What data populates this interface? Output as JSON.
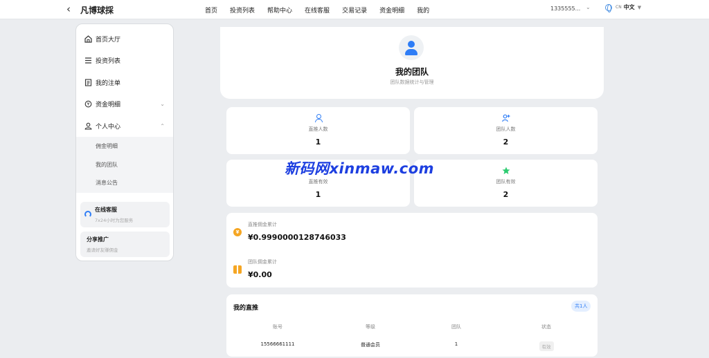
{
  "header": {
    "brand": "凡博球採",
    "nav": [
      "首页",
      "投资列表",
      "帮助中心",
      "在线客服",
      "交易记录",
      "资金明细",
      "我的"
    ],
    "account": "1335555...",
    "lang_code": "CN",
    "lang_name": "中文"
  },
  "sidebar": {
    "items": [
      {
        "label": "首页大厅",
        "icon": "home-icon"
      },
      {
        "label": "投资列表",
        "icon": "list-icon"
      },
      {
        "label": "我的注单",
        "icon": "document-icon"
      },
      {
        "label": "资金明细",
        "icon": "coin-icon"
      },
      {
        "label": "个人中心",
        "icon": "user-icon"
      }
    ],
    "submenu": [
      "佣金明细",
      "我的团队",
      "消息公告"
    ],
    "service": {
      "title": "在线客服",
      "subtitle": "7x24小时为您服务"
    },
    "share": {
      "title": "分享推广",
      "subtitle": "邀请好友赚佣金"
    }
  },
  "hero": {
    "title": "我的团队",
    "subtitle": "团队数据统计与管理"
  },
  "stats": [
    {
      "label": "直推人数",
      "value": "1",
      "icon": "user-icon"
    },
    {
      "label": "团队人数",
      "value": "2",
      "icon": "user-add-icon"
    },
    {
      "label": "直推有效",
      "value": "1",
      "icon": "check-icon"
    },
    {
      "label": "团队有效",
      "value": "2",
      "icon": "star-icon"
    }
  ],
  "commission": {
    "direct_label": "直推佣金累计",
    "direct_value": "¥0.9990000128746033",
    "team_label": "团队佣金累计",
    "team_value": "¥0.00"
  },
  "direct_list": {
    "title": "我的直推",
    "count": "共1人",
    "columns": [
      "账号",
      "等级",
      "团队",
      "状态"
    ],
    "rows": [
      {
        "account": "15566661111",
        "level": "普通会员",
        "team": "1",
        "status": "有效"
      }
    ]
  },
  "watermark": "新码网xinmaw.com",
  "colors": {
    "accent": "#2e7df6",
    "gold": "#f5a623",
    "green": "#2ecc71"
  }
}
